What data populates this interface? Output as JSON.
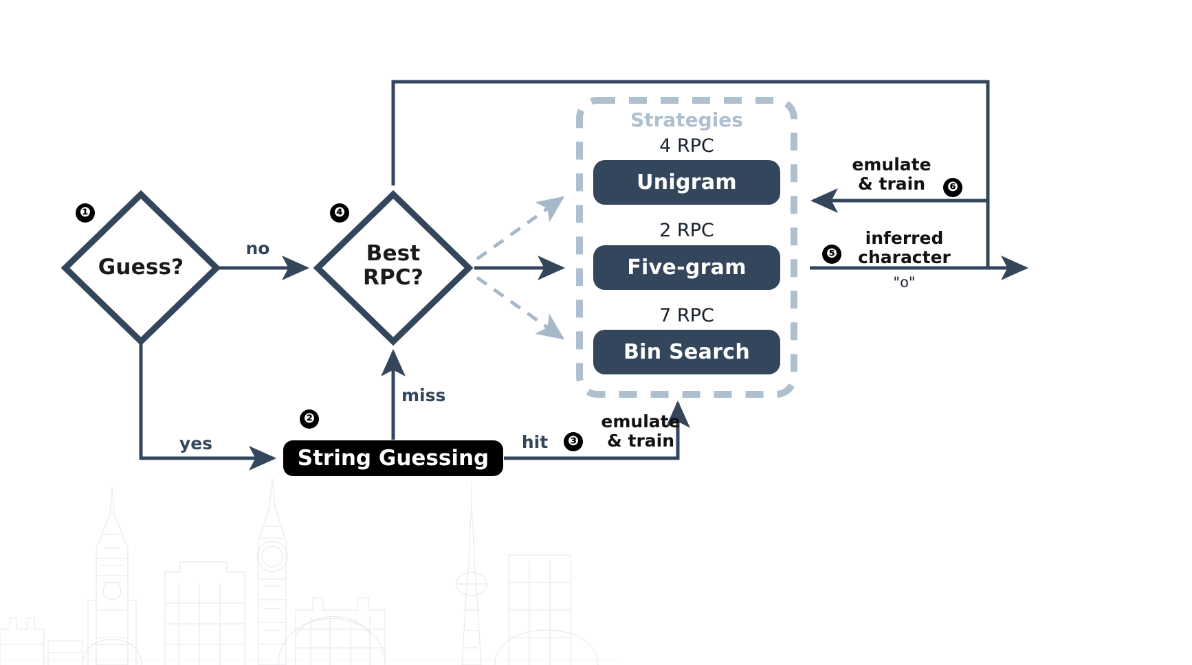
{
  "diagram": {
    "title": "String Guessing Strategy Flowchart",
    "colors": {
      "line": "#33465c",
      "dashed_box": "#aebfd0",
      "pill_fill": "#33465c",
      "black_fill": "#000000",
      "text_dark": "#111111",
      "strategies_title": "#aebfd0"
    },
    "nodes": {
      "guess": {
        "label": "Guess?",
        "badge": "❶"
      },
      "best_rpc": {
        "label": "Best\nRPC?",
        "badge": "❹"
      },
      "string_guessing": {
        "label": "String Guessing",
        "badge": "❷"
      }
    },
    "strategies": {
      "title": "Strategies",
      "items": [
        {
          "rpc": "4 RPC",
          "label": "Unigram"
        },
        {
          "rpc": "2 RPC",
          "label": "Five-gram"
        },
        {
          "rpc": "7 RPC",
          "label": "Bin Search"
        }
      ]
    },
    "edges": {
      "no": "no",
      "yes": "yes",
      "miss": "miss",
      "hit": "hit",
      "emulate_train_bottom": "emulate\n& train",
      "emulate_train_bottom_badge": "❸",
      "emulate_train_right": "emulate\n& train",
      "emulate_train_right_badge": "❻",
      "inferred_character": "inferred\ncharacter",
      "inferred_character_badge": "❺",
      "inferred_character_value": "\"o\""
    }
  }
}
